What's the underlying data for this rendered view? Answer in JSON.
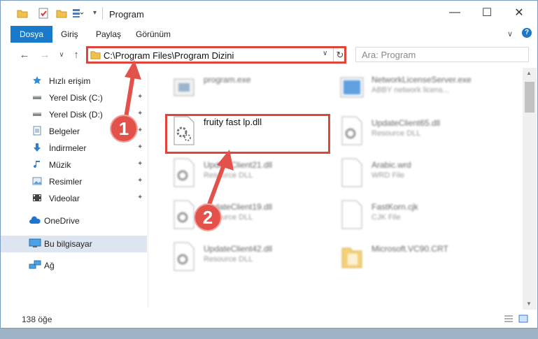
{
  "window": {
    "title": "Program",
    "controls": {
      "minimize": "—",
      "maximize": "☐",
      "close": "✕"
    }
  },
  "ribbon": {
    "tabs": [
      "Dosya",
      "Giriş",
      "Paylaş",
      "Görünüm"
    ],
    "collapse_glyph": "∨",
    "help_glyph": "?"
  },
  "navigation": {
    "back": "←",
    "forward": "→",
    "recent": "∨",
    "up": "↑",
    "address": "C:\\Program Files\\Program Dizini",
    "address_dropdown": "∨",
    "refresh": "↻",
    "search_placeholder": "Ara: Program"
  },
  "sidebar": {
    "items": [
      {
        "label": "Hızlı erişim",
        "icon": "star-icon",
        "pinned": false
      },
      {
        "label": "Yerel Disk (C:)",
        "icon": "drive-icon",
        "pinned": true
      },
      {
        "label": "Yerel Disk (D:)",
        "icon": "drive-icon",
        "pinned": true
      },
      {
        "label": "Belgeler",
        "icon": "documents-icon",
        "pinned": true
      },
      {
        "label": "İndirmeler",
        "icon": "download-icon",
        "pinned": true
      },
      {
        "label": "Müzik",
        "icon": "music-icon",
        "pinned": true
      },
      {
        "label": "Resimler",
        "icon": "pictures-icon",
        "pinned": true
      },
      {
        "label": "Videolar",
        "icon": "videos-icon",
        "pinned": true
      },
      {
        "label": "OneDrive",
        "icon": "cloud-icon",
        "pinned": false
      },
      {
        "label": "Bu bilgisayar",
        "icon": "computer-icon",
        "pinned": false
      },
      {
        "label": "Ağ",
        "icon": "network-icon",
        "pinned": false
      }
    ],
    "pin_glyph": "📌"
  },
  "files": [
    {
      "name": "program.exe",
      "desc": "",
      "icon": "exe-icon"
    },
    {
      "name": "NetworkLicenseServer.exe",
      "desc": "ABBY network licens...",
      "icon": "exe-icon"
    },
    {
      "name": "fruity fast lp.dll",
      "desc": "",
      "icon": "dll-gear-icon"
    },
    {
      "name": "UpdateClient65.dll",
      "desc": "Resource DLL",
      "icon": "dll-gear-icon"
    },
    {
      "name": "UpdateClient21.dll",
      "desc": "Resource DLL",
      "icon": "dll-gear-icon"
    },
    {
      "name": "Arabic.wrd",
      "desc": "WRD File",
      "icon": "file-icon"
    },
    {
      "name": "UpdateClient19.dll",
      "desc": "Resource DLL",
      "icon": "dll-gear-icon"
    },
    {
      "name": "FastKorn.cjk",
      "desc": "CJK File",
      "icon": "file-icon"
    },
    {
      "name": "UpdateClient42.dll",
      "desc": "Resource DLL",
      "icon": "dll-gear-icon"
    },
    {
      "name": "Microsoft.VC90.CRT",
      "desc": "",
      "icon": "folder-icon"
    }
  ],
  "status": {
    "count": "138 öğe"
  },
  "annotations": {
    "step1": "1",
    "step2": "2"
  },
  "colors": {
    "accent": "#1979ca",
    "highlight": "#e0453a",
    "badge": "#e3514b",
    "folder": "#f0c24b"
  }
}
